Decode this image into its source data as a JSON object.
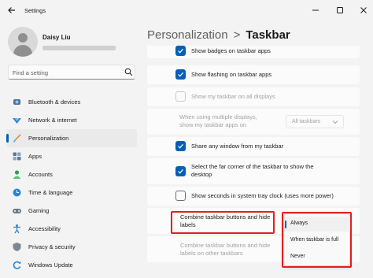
{
  "window": {
    "title": "Settings"
  },
  "user": {
    "name": "Daisy Liu"
  },
  "search": {
    "placeholder": "Find a setting"
  },
  "sidebar": {
    "items": [
      {
        "label": "Bluetooth & devices",
        "icon": "bluetooth-icon"
      },
      {
        "label": "Network & internet",
        "icon": "network-icon"
      },
      {
        "label": "Personalization",
        "icon": "brush-icon",
        "active": true
      },
      {
        "label": "Apps",
        "icon": "apps-icon"
      },
      {
        "label": "Accounts",
        "icon": "accounts-icon"
      },
      {
        "label": "Time & language",
        "icon": "globe-clock-icon"
      },
      {
        "label": "Gaming",
        "icon": "gamepad-icon"
      },
      {
        "label": "Accessibility",
        "icon": "accessibility-icon"
      },
      {
        "label": "Privacy & security",
        "icon": "shield-icon"
      },
      {
        "label": "Windows Update",
        "icon": "update-icon"
      }
    ]
  },
  "breadcrumb": {
    "parent": "Personalization",
    "separator": ">",
    "current": "Taskbar"
  },
  "settings": {
    "show_badges": {
      "label": "Show badges on taskbar apps",
      "checked": true
    },
    "show_flashing": {
      "label": "Show flashing on taskbar apps",
      "checked": true
    },
    "show_all_displays": {
      "label": "Show my taskbar on all displays",
      "checked": false,
      "disabled": true
    },
    "multiple_displays": {
      "line1": "When using multiple displays,",
      "line2": "show my taskbar apps on",
      "value": "All taskbars",
      "disabled": true
    },
    "share_window": {
      "label": "Share any window from my taskbar",
      "checked": true
    },
    "far_corner": {
      "line1": "Select the far corner of the taskbar to show the",
      "line2": "desktop",
      "checked": true
    },
    "show_seconds": {
      "label": "Show seconds in system tray clock (uses more power)",
      "checked": false
    },
    "combine_buttons": {
      "line1": "Combine taskbar buttons and hide",
      "line2": "labels"
    },
    "combine_other": {
      "line1": "Combine taskbar buttons and hide",
      "line2": "labels on other taskbars",
      "disabled": true
    }
  },
  "combine_menu": {
    "options": [
      "Always",
      "When taskbar is full",
      "Never"
    ],
    "selected": "Always"
  },
  "colors": {
    "accent": "#005fb8",
    "highlight": "#e02020"
  }
}
